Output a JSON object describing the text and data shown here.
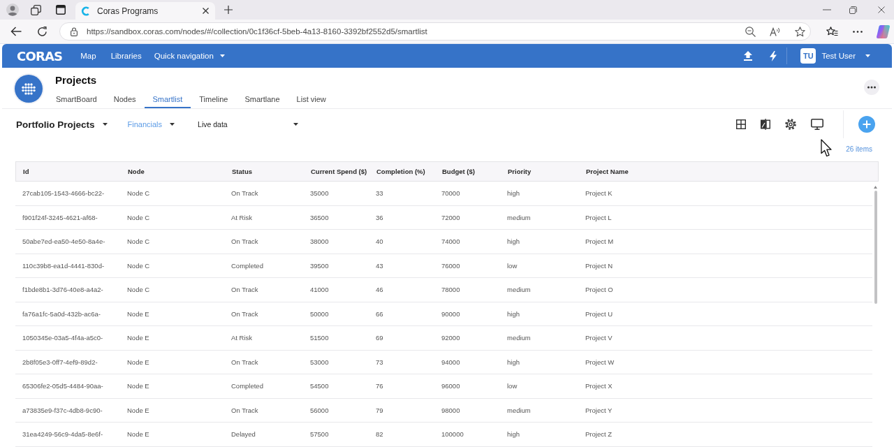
{
  "browser": {
    "tab_title": "Coras Programs",
    "url": "https://sandbox.coras.com/nodes/#/collection/0c1f36cf-5beb-4a13-8160-3392bf2552d5/smartlist"
  },
  "app_header": {
    "logo": "CORAS",
    "nav": [
      {
        "label": "Map",
        "kind": "link"
      },
      {
        "label": "Libraries",
        "kind": "link"
      },
      {
        "label": "Quick navigation",
        "kind": "menu"
      }
    ],
    "user": {
      "initials": "TU",
      "name": "Test User"
    }
  },
  "page": {
    "title": "Projects",
    "tabs": [
      {
        "label": "SmartBoard",
        "selected": false
      },
      {
        "label": "Nodes",
        "selected": false
      },
      {
        "label": "Smartlist",
        "selected": true
      },
      {
        "label": "Timeline",
        "selected": false
      },
      {
        "label": "Smartlane",
        "selected": false
      },
      {
        "label": "List view",
        "selected": false
      }
    ]
  },
  "toolbar": {
    "view": "Portfolio Projects",
    "filter": "Financials",
    "source": "Live data",
    "item_count": "26 items"
  },
  "table": {
    "columns": [
      "Id",
      "Node",
      "Status",
      "Current Spend ($)",
      "Completion (%)",
      "Budget ($)",
      "Priority",
      "Project Name"
    ],
    "rows": [
      [
        "27cab105-1543-4666-bc22-",
        "Node C",
        "On Track",
        "35000",
        "33",
        "70000",
        "high",
        "Project K"
      ],
      [
        "f901f24f-3245-4621-af68-",
        "Node C",
        "At Risk",
        "36500",
        "36",
        "72000",
        "medium",
        "Project L"
      ],
      [
        "50abe7ed-ea50-4e50-8a4e-",
        "Node C",
        "On Track",
        "38000",
        "40",
        "74000",
        "high",
        "Project M"
      ],
      [
        "110c39b8-ea1d-4441-830d-",
        "Node C",
        "Completed",
        "39500",
        "43",
        "76000",
        "low",
        "Project N"
      ],
      [
        "f1bde8b1-3d76-40e8-a4a2-",
        "Node C",
        "On Track",
        "41000",
        "46",
        "78000",
        "medium",
        "Project O"
      ],
      [
        "fa76a1fc-5a0d-432b-ac6a-",
        "Node E",
        "On Track",
        "50000",
        "66",
        "90000",
        "high",
        "Project U"
      ],
      [
        "1050345e-03a5-4f4a-a5c0-",
        "Node E",
        "At Risk",
        "51500",
        "69",
        "92000",
        "medium",
        "Project V"
      ],
      [
        "2b8f05e3-0ff7-4ef9-89d2-",
        "Node E",
        "On Track",
        "53000",
        "73",
        "94000",
        "high",
        "Project W"
      ],
      [
        "65306fe2-05d5-4484-90aa-",
        "Node E",
        "Completed",
        "54500",
        "76",
        "96000",
        "low",
        "Project X"
      ],
      [
        "a73835e9-f37c-4db8-9c90-",
        "Node E",
        "On Track",
        "56000",
        "79",
        "98000",
        "medium",
        "Project Y"
      ],
      [
        "31ea4249-56c9-4da5-8e6f-",
        "Node E",
        "Delayed",
        "57500",
        "82",
        "100000",
        "high",
        "Project Z"
      ]
    ]
  }
}
